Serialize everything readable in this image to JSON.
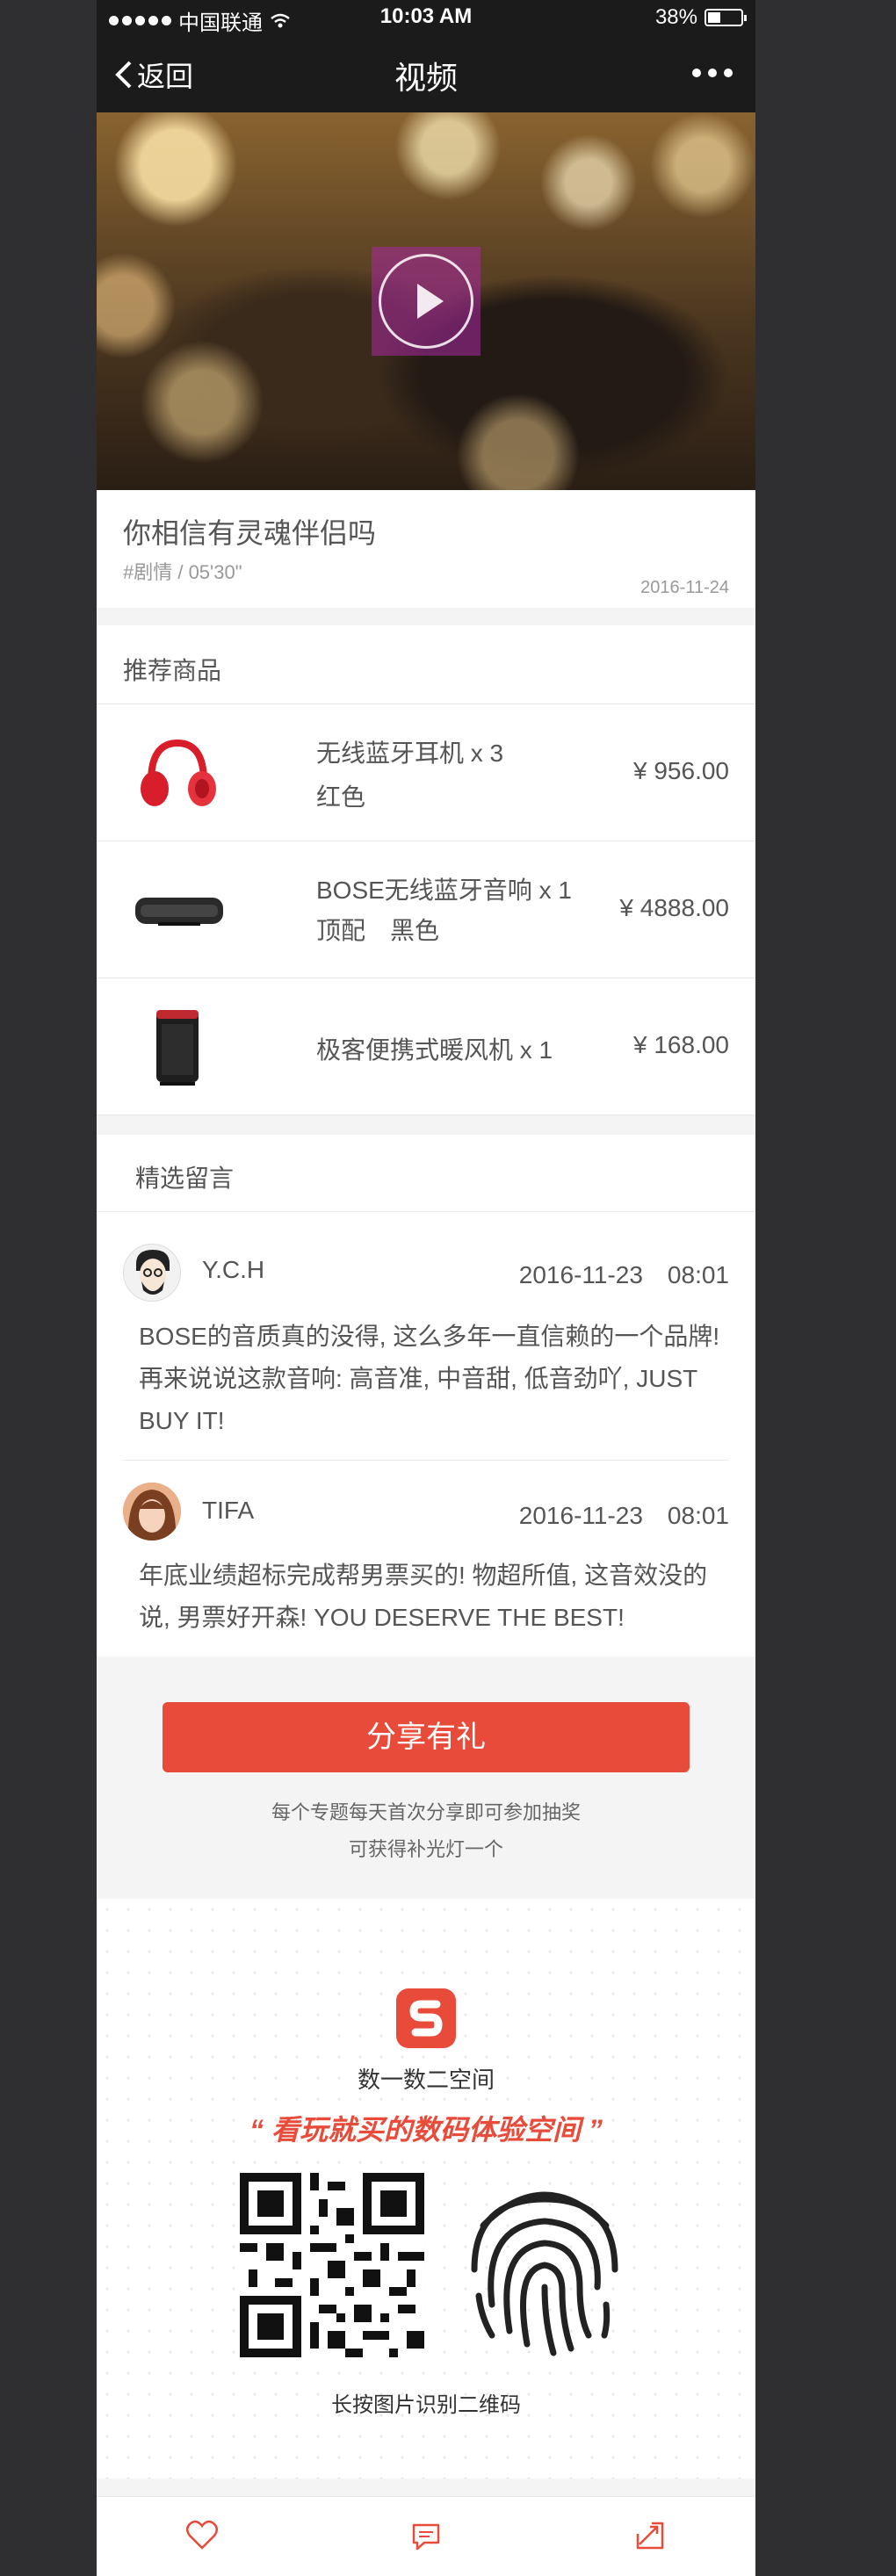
{
  "status_bar": {
    "carrier": "中国联通",
    "time": "10:03 AM",
    "battery": "38%"
  },
  "nav": {
    "back_label": "返回",
    "title": "视频"
  },
  "video": {
    "title": "你相信有灵魂伴侣吗",
    "tag": "#剧情 / 05'30\"",
    "date": "2016-11-24"
  },
  "recommend": {
    "header": "推荐商品",
    "products": [
      {
        "name": "无线蓝牙耳机 x 3",
        "spec": "红色",
        "price": "¥ 956.00",
        "icon": "red-headphones"
      },
      {
        "name": "BOSE无线蓝牙音响 x 1",
        "spec": "顶配　黑色",
        "price": "¥ 4888.00",
        "icon": "black-speaker"
      },
      {
        "name": "极客便携式暖风机 x 1",
        "spec": "",
        "price": "¥ 168.00",
        "icon": "heater"
      }
    ]
  },
  "comments": {
    "header": "精选留言",
    "items": [
      {
        "name": "Y.C.H",
        "date": "2016-11-23　08:01",
        "body": "BOSE的音质真的没得, 这么多年一直信赖的一个品牌! 再来说说这款音响: 高音准, 中音甜, 低音劲吖, JUST BUY IT!"
      },
      {
        "name": "TIFA",
        "date": "2016-11-23　08:01",
        "body": "年底业绩超标完成帮男票买的! 物超所值, 这音效没的说, 男票好开森! YOU DESERVE THE BEST!"
      }
    ]
  },
  "share": {
    "button_label": "分享有礼",
    "note_line1": "每个专题每天首次分享即可参加抽奖",
    "note_line2": "可获得补光灯一个"
  },
  "poster": {
    "brand_name": "数一数二空间",
    "slogan": "“ 看玩就买的数码体验空间 ”",
    "caption": "长按图片识别二维码"
  },
  "toolbar": {
    "icons": [
      "heart-icon",
      "comment-icon",
      "share-icon"
    ]
  },
  "colors": {
    "accent": "#e84b3a",
    "text": "#555555",
    "muted": "#999999",
    "divider": "#eaeaea",
    "background": "#f4f4f4"
  }
}
